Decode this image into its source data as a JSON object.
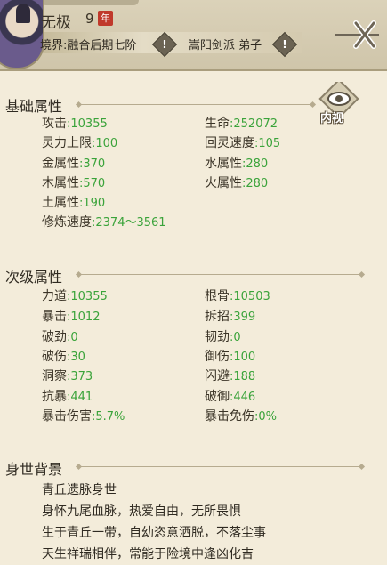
{
  "header": {
    "name": "无极",
    "age": "9",
    "age_badge": "年",
    "realm": "境界:融合后期七阶",
    "sect": "嵩阳剑派 弟子",
    "info_icon": "exclamation-icon"
  },
  "inspect_button": {
    "label": "内视"
  },
  "basic": {
    "title": "基础属性",
    "items": [
      {
        "label": "攻击",
        "value": ":10355"
      },
      {
        "label": "生命",
        "value": ":252072"
      },
      {
        "label": "灵力上限",
        "value": ":100"
      },
      {
        "label": "回灵速度",
        "value": ":105"
      },
      {
        "label": "金属性",
        "value": ":370"
      },
      {
        "label": "水属性",
        "value": ":280"
      },
      {
        "label": "木属性",
        "value": ":570"
      },
      {
        "label": "火属性",
        "value": ":280"
      },
      {
        "label": "土属性",
        "value": ":190"
      },
      {
        "label": "修炼速度",
        "value": ":2374～3561"
      }
    ]
  },
  "secondary": {
    "title": "次级属性",
    "items": [
      {
        "label": "力道",
        "value": ":10355"
      },
      {
        "label": "根骨",
        "value": ":10503"
      },
      {
        "label": "暴击",
        "value": ":1012"
      },
      {
        "label": "拆招",
        "value": ":399"
      },
      {
        "label": "破劲",
        "value": ":0"
      },
      {
        "label": "韧劲",
        "value": ":0"
      },
      {
        "label": "破伤",
        "value": ":30"
      },
      {
        "label": "御伤",
        "value": ":100"
      },
      {
        "label": "洞察",
        "value": ":373"
      },
      {
        "label": "闪避",
        "value": ":188"
      },
      {
        "label": "抗暴",
        "value": ":441"
      },
      {
        "label": "破御",
        "value": ":446"
      },
      {
        "label": "暴击伤害",
        "value": ":5.7%"
      },
      {
        "label": "暴击免伤",
        "value": ":0%"
      }
    ]
  },
  "background": {
    "title": "身世背景",
    "lines": [
      "青丘遗脉身世",
      "身怀九尾血脉，热爱自由，无所畏惧",
      "生于青丘一带，自幼恣意洒脱，不落尘事",
      "天生祥瑞相伴，常能于险境中逢凶化吉"
    ]
  },
  "colors": {
    "value_green": "#3aa33a",
    "badge_red": "#c0392b",
    "panel_bg": "#f3ecda"
  }
}
